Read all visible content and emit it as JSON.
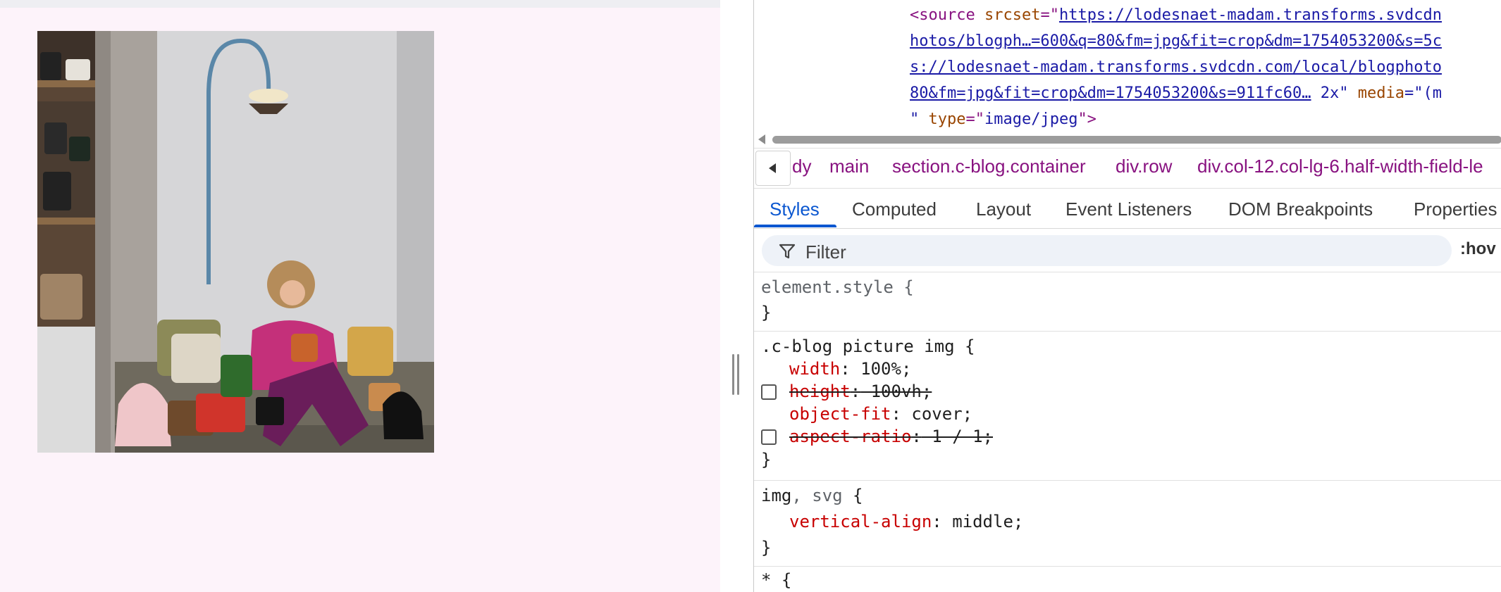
{
  "devtools": {
    "elements": {
      "line1": {
        "indent_tag": "<source ",
        "attr": "srcset",
        "eq": "=\"",
        "url": "https://lodesnaet-madam.transforms.svdcdn"
      },
      "line2": {
        "url": "hotos/blogph…=600&q=80&fm=jpg&fit=crop&dm=1754053200&s=5c"
      },
      "line3": {
        "url": "s://lodesnaet-madam.transforms.svdcdn.com/local/blogphoto"
      },
      "line4": {
        "url": "80&fm=jpg&fit=crop&dm=1754053200&s=911fc60…",
        "suffix": " 2x\"",
        "attr": " media",
        "tail": "=\"(m"
      },
      "line5": {
        "quote": "\" ",
        "attr": "type",
        "eq": "=\"",
        "val": "image/jpeg",
        "end": "\">"
      }
    },
    "breadcrumbs": [
      "dy",
      "main",
      "section.c-blog.container",
      "div.row",
      "div.col-12.col-lg-6.half-width-field-le"
    ],
    "tabs": [
      "Styles",
      "Computed",
      "Layout",
      "Event Listeners",
      "DOM Breakpoints",
      "Properties"
    ],
    "active_tab": "Styles",
    "filter": {
      "placeholder": "Filter"
    },
    "hov_label": ":hov",
    "rules": {
      "element_style": {
        "selector": "element.style {",
        "close": "}"
      },
      "cblog": {
        "selector": ".c-blog picture img {",
        "decls": [
          {
            "prop": "width",
            "value": "100%;",
            "enabled": true
          },
          {
            "prop": "height",
            "value": " 100vh;",
            "enabled": false
          },
          {
            "prop": "object-fit",
            "value": "cover;",
            "enabled": true
          },
          {
            "prop": "aspect-ratio",
            "value": " 1 / 1;",
            "enabled": false
          }
        ],
        "close": "}"
      },
      "imgsvg": {
        "sel_main": "img",
        "sel_rest": ", svg",
        "brace": " {",
        "decl": {
          "prop": "vertical-align",
          "value": "middle;"
        },
        "close": "}"
      },
      "universal": {
        "selector": "* {"
      }
    }
  },
  "colors": {
    "page_bg": "#fdf3fa",
    "accent": "#0b57d0",
    "tag": "#881280",
    "prop": "#c80000"
  }
}
